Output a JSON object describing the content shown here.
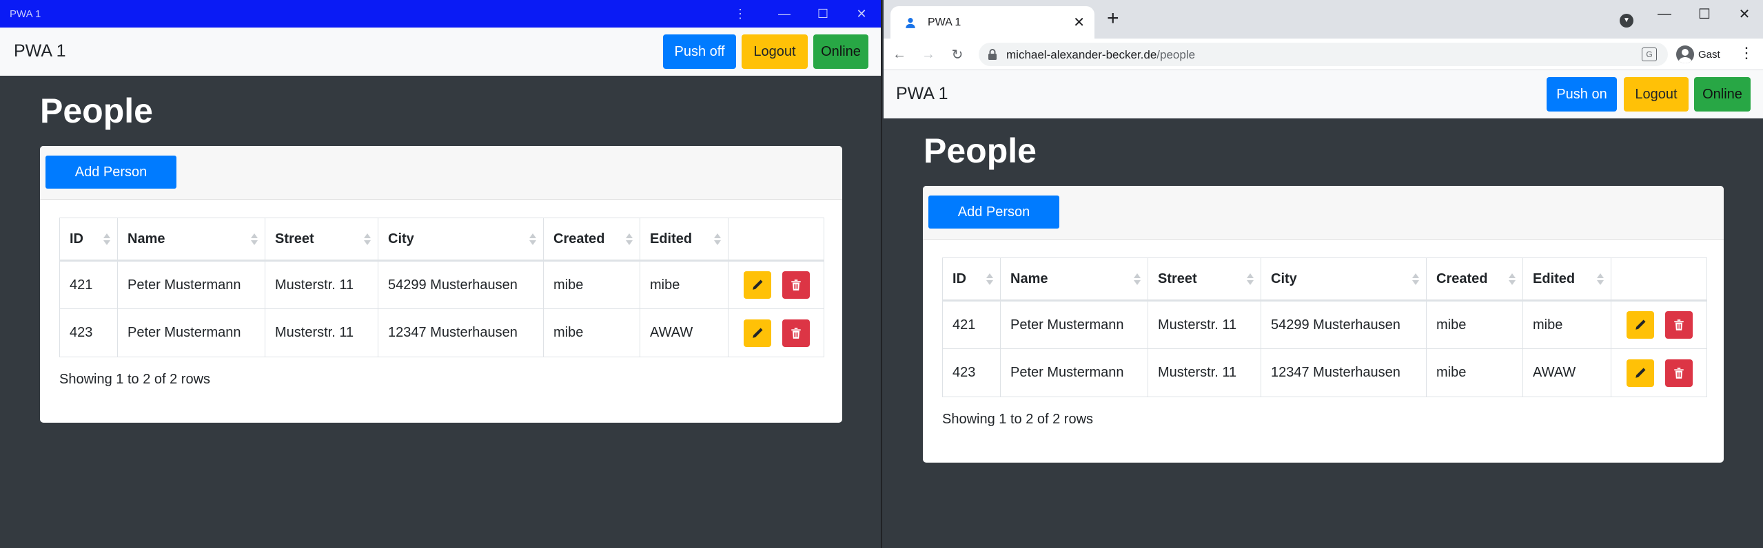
{
  "left_window": {
    "titlebar": {
      "title": "PWA 1"
    },
    "navbar": {
      "brand": "PWA 1",
      "push_label": "Push off",
      "logout_label": "Logout",
      "status_label": "Online"
    },
    "page_title": "People",
    "add_button": "Add Person",
    "columns": [
      "ID",
      "Name",
      "Street",
      "City",
      "Created",
      "Edited"
    ],
    "rows": [
      {
        "id": "421",
        "name": "Peter Mustermann",
        "street": "Musterstr. 11",
        "city": "54299 Musterhausen",
        "created": "mibe",
        "edited": "mibe"
      },
      {
        "id": "423",
        "name": "Peter Mustermann",
        "street": "Musterstr. 11",
        "city": "12347 Musterhausen",
        "created": "mibe",
        "edited": "AWAW"
      }
    ],
    "footer": "Showing 1 to 2 of 2 rows"
  },
  "right_window": {
    "tab": {
      "title": "PWA 1"
    },
    "address": {
      "host": "michael-alexander-becker.de",
      "path": "/people"
    },
    "profile": {
      "label": "Gast"
    },
    "navbar": {
      "brand": "PWA 1",
      "push_label": "Push on",
      "logout_label": "Logout",
      "status_label": "Online"
    },
    "page_title": "People",
    "add_button": "Add Person",
    "columns": [
      "ID",
      "Name",
      "Street",
      "City",
      "Created",
      "Edited"
    ],
    "rows": [
      {
        "id": "421",
        "name": "Peter Mustermann",
        "street": "Musterstr. 11",
        "city": "54299 Musterhausen",
        "created": "mibe",
        "edited": "mibe"
      },
      {
        "id": "423",
        "name": "Peter Mustermann",
        "street": "Musterstr. 11",
        "city": "12347 Musterhausen",
        "created": "mibe",
        "edited": "AWAW"
      }
    ],
    "footer": "Showing 1 to 2 of 2 rows"
  },
  "colors": {
    "pwa_titlebar": "#0a1bf5",
    "page_background": "#343a40",
    "primary": "#007bff",
    "warning": "#ffc107",
    "success": "#28a745",
    "danger": "#dc3545"
  },
  "icons": [
    "pencil-icon",
    "trash-icon",
    "lock-icon",
    "back-arrow-icon",
    "forward-arrow-icon",
    "reload-icon",
    "translate-icon",
    "profile-icon",
    "menu-icon",
    "minimize-icon",
    "maximize-icon",
    "close-icon",
    "new-tab-icon",
    "tab-search-icon"
  ]
}
